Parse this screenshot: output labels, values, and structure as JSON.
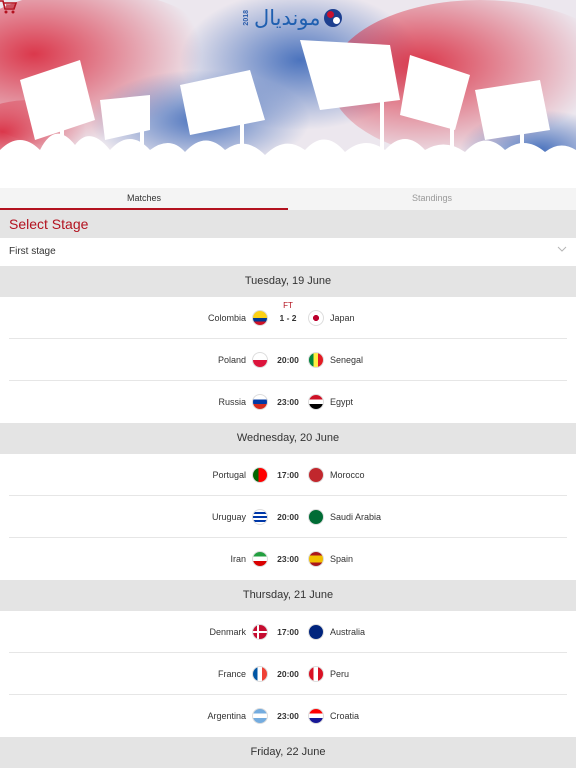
{
  "app": {
    "logo_arabic": "مونديال",
    "logo_year": "2018"
  },
  "tabs": [
    {
      "label": "Matches",
      "active": true
    },
    {
      "label": "Standings",
      "active": false
    }
  ],
  "stage": {
    "title": "Select Stage",
    "selected": "First stage"
  },
  "days": [
    {
      "date": "Tuesday, 19 June",
      "matches": [
        {
          "home": "Colombia",
          "away": "Japan",
          "time": "1 - 2",
          "status": "FT",
          "home_flag": "colombia",
          "away_flag": "japan"
        },
        {
          "home": "Poland",
          "away": "Senegal",
          "time": "20:00",
          "status": "",
          "home_flag": "poland",
          "away_flag": "senegal"
        },
        {
          "home": "Russia",
          "away": "Egypt",
          "time": "23:00",
          "status": "",
          "home_flag": "russia",
          "away_flag": "egypt"
        }
      ]
    },
    {
      "date": "Wednesday, 20 June",
      "matches": [
        {
          "home": "Portugal",
          "away": "Morocco",
          "time": "17:00",
          "status": "",
          "home_flag": "portugal",
          "away_flag": "morocco"
        },
        {
          "home": "Uruguay",
          "away": "Saudi Arabia",
          "time": "20:00",
          "status": "",
          "home_flag": "uruguay",
          "away_flag": "saudi"
        },
        {
          "home": "Iran",
          "away": "Spain",
          "time": "23:00",
          "status": "",
          "home_flag": "iran",
          "away_flag": "spain"
        }
      ]
    },
    {
      "date": "Thursday, 21 June",
      "matches": [
        {
          "home": "Denmark",
          "away": "Australia",
          "time": "17:00",
          "status": "",
          "home_flag": "denmark",
          "away_flag": "australia"
        },
        {
          "home": "France",
          "away": "Peru",
          "time": "20:00",
          "status": "",
          "home_flag": "france",
          "away_flag": "peru"
        },
        {
          "home": "Argentina",
          "away": "Croatia",
          "time": "23:00",
          "status": "",
          "home_flag": "argentina",
          "away_flag": "croatia"
        }
      ]
    },
    {
      "date": "Friday, 22 June",
      "matches": []
    }
  ],
  "colors": {
    "accent": "#b3121f",
    "header_bg": "#e4e4e4"
  }
}
